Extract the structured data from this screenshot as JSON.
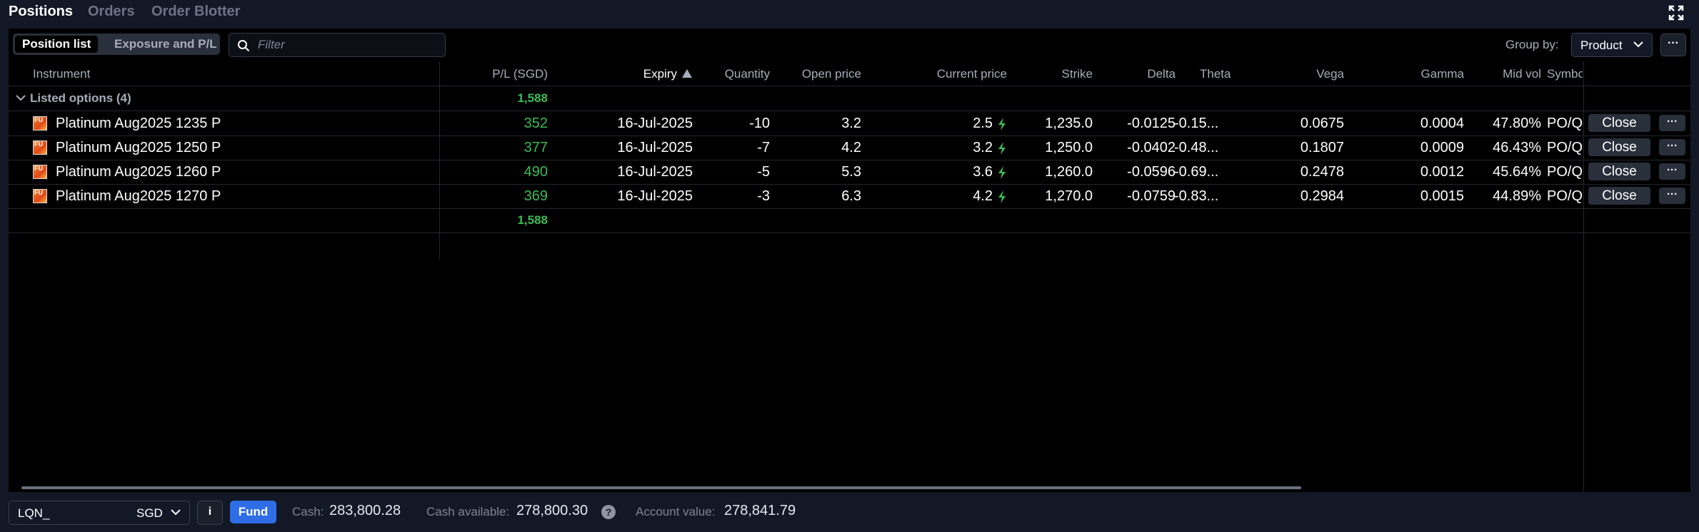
{
  "tabs": [
    "Positions",
    "Orders",
    "Order Blotter"
  ],
  "toolbar": {
    "view_options": [
      "Position list",
      "Exposure and P/L"
    ],
    "filter_placeholder": "Filter",
    "group_by_label": "Group by:",
    "group_by_value": "Product",
    "more": "···"
  },
  "columns": {
    "instrument": "Instrument",
    "pl": "P/L (SGD)",
    "expiry": "Expiry",
    "quantity": "Quantity",
    "open_price": "Open price",
    "current_price": "Current price",
    "strike": "Strike",
    "delta": "Delta",
    "theta": "Theta",
    "vega": "Vega",
    "gamma": "Gamma",
    "mid_vol": "Mid vol",
    "symbol": "Symbo"
  },
  "group": {
    "label": "Listed options (4)",
    "total_pl": "1,588"
  },
  "rows": [
    {
      "icon_text": "FU",
      "instrument": "Platinum Aug2025 1235 P",
      "pl": "352",
      "expiry": "16-Jul-2025",
      "quantity": "-10",
      "open_price": "3.2",
      "current_price": "2.5",
      "strike": "1,235.0",
      "delta": "-0.0125",
      "theta": "-0.15...",
      "vega": "0.0675",
      "gamma": "0.0004",
      "mid_vol": "47.80%",
      "symbol": "PO/Q",
      "action": "Close",
      "more": "···"
    },
    {
      "icon_text": "FU",
      "instrument": "Platinum Aug2025 1250 P",
      "pl": "377",
      "expiry": "16-Jul-2025",
      "quantity": "-7",
      "open_price": "4.2",
      "current_price": "3.2",
      "strike": "1,250.0",
      "delta": "-0.0402",
      "theta": "-0.48...",
      "vega": "0.1807",
      "gamma": "0.0009",
      "mid_vol": "46.43%",
      "symbol": "PO/Q",
      "action": "Close",
      "more": "···"
    },
    {
      "icon_text": "FU",
      "instrument": "Platinum Aug2025 1260 P",
      "pl": "490",
      "expiry": "16-Jul-2025",
      "quantity": "-5",
      "open_price": "5.3",
      "current_price": "3.6",
      "strike": "1,260.0",
      "delta": "-0.0596",
      "theta": "-0.69...",
      "vega": "0.2478",
      "gamma": "0.0012",
      "mid_vol": "45.64%",
      "symbol": "PO/Q",
      "action": "Close",
      "more": "···"
    },
    {
      "icon_text": "FU",
      "instrument": "Platinum Aug2025 1270 P",
      "pl": "369",
      "expiry": "16-Jul-2025",
      "quantity": "-3",
      "open_price": "6.3",
      "current_price": "4.2",
      "strike": "1,270.0",
      "delta": "-0.0759",
      "theta": "-0.83...",
      "vega": "0.2984",
      "gamma": "0.0015",
      "mid_vol": "44.89%",
      "symbol": "PO/Q",
      "action": "Close",
      "more": "···"
    }
  ],
  "total_pl": "1,588",
  "footer": {
    "account": "LQN_",
    "currency": "SGD",
    "info": "i",
    "fund": "Fund",
    "cash_label": "Cash:",
    "cash": "283,800.28",
    "cash_available_label": "Cash available:",
    "cash_available": "278,800.30",
    "help": "?",
    "account_value_label": "Account value:",
    "account_value": "278,841.79"
  },
  "colors": {
    "profit": "#3dbb55",
    "accent": "#2e6de6",
    "background": "#121826",
    "grid": "#000000"
  }
}
